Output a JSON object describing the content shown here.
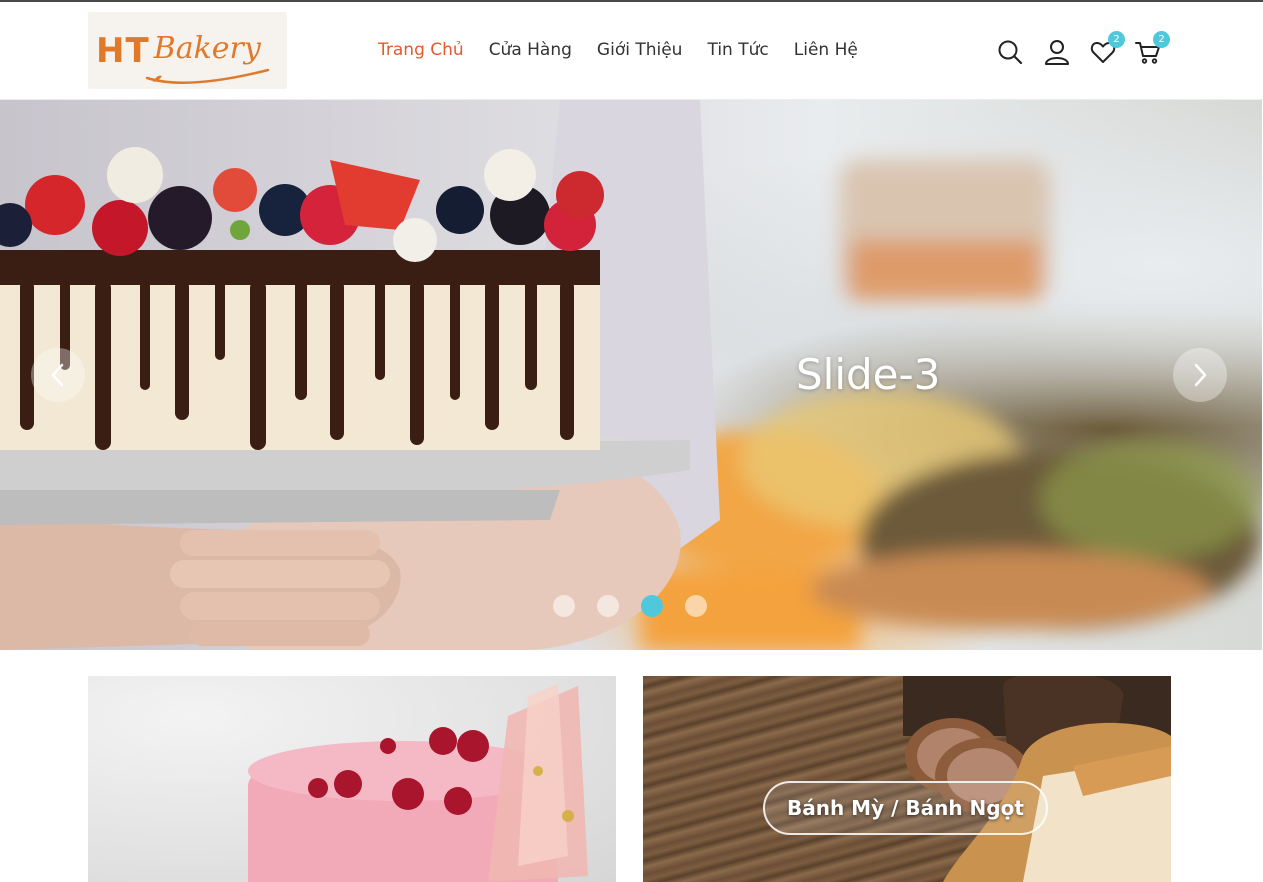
{
  "header": {
    "logo": {
      "primary": "HT",
      "secondary": "Bakery"
    },
    "nav": [
      {
        "label": "Trang Chủ",
        "active": true
      },
      {
        "label": "Cửa Hàng",
        "active": false
      },
      {
        "label": "Giới Thiệu",
        "active": false
      },
      {
        "label": "Tin Tức",
        "active": false
      },
      {
        "label": "Liên Hệ",
        "active": false
      }
    ],
    "wishlist_count": "2",
    "cart_count": "2",
    "colors": {
      "accent": "#e35b2c",
      "badge": "#4fc8dc",
      "logo": "#e0792a"
    },
    "icons": [
      "search-icon",
      "user-icon",
      "heart-icon",
      "cart-icon"
    ]
  },
  "hero": {
    "slide_title": "Slide-3",
    "total_slides": 4,
    "active_slide": 3,
    "icons": [
      "chevron-left-icon",
      "chevron-right-icon"
    ]
  },
  "categories": [
    {
      "label": ""
    },
    {
      "label": "Bánh Mỳ / Bánh Ngọt"
    }
  ]
}
